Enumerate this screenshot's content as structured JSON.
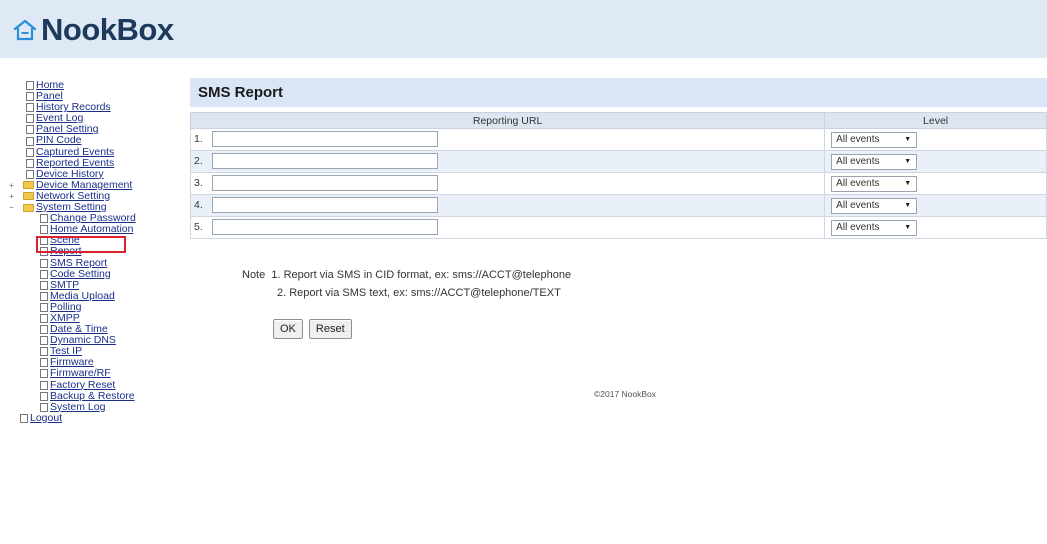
{
  "header": {
    "brand": "NookBox",
    "colors": {
      "header_bg": "#dfe9f5",
      "brand": "#1d3a5c"
    }
  },
  "sidebar": {
    "items": [
      {
        "label": "Home",
        "type": "doc",
        "level": 0
      },
      {
        "label": "Panel",
        "type": "doc",
        "level": 0
      },
      {
        "label": "History Records",
        "type": "doc",
        "level": 0
      },
      {
        "label": "Event Log",
        "type": "doc",
        "level": 0
      },
      {
        "label": "Panel Setting",
        "type": "doc",
        "level": 0
      },
      {
        "label": "PIN Code",
        "type": "doc",
        "level": 0
      },
      {
        "label": "Captured Events",
        "type": "doc",
        "level": 0
      },
      {
        "label": "Reported Events",
        "type": "doc",
        "level": 0
      },
      {
        "label": "Device History",
        "type": "doc",
        "level": 0
      },
      {
        "label": "Device Management",
        "type": "folder",
        "level": 0,
        "expander": "+"
      },
      {
        "label": "Network Setting",
        "type": "folder",
        "level": 0,
        "expander": "+"
      },
      {
        "label": "System Setting",
        "type": "folder",
        "level": 0,
        "expander": "−"
      },
      {
        "label": "Change Password",
        "type": "doc",
        "level": 1
      },
      {
        "label": "Home Automation",
        "type": "doc",
        "level": 1
      },
      {
        "label": "Scene",
        "type": "doc",
        "level": 1
      },
      {
        "label": "Report",
        "type": "doc",
        "level": 1
      },
      {
        "label": "SMS Report",
        "type": "doc",
        "level": 1,
        "selected": true
      },
      {
        "label": "Code Setting",
        "type": "doc",
        "level": 1
      },
      {
        "label": "SMTP",
        "type": "doc",
        "level": 1
      },
      {
        "label": "Media Upload",
        "type": "doc",
        "level": 1
      },
      {
        "label": "Polling",
        "type": "doc",
        "level": 1
      },
      {
        "label": "XMPP",
        "type": "doc",
        "level": 1
      },
      {
        "label": "Date & Time",
        "type": "doc",
        "level": 1
      },
      {
        "label": "Dynamic DNS",
        "type": "doc",
        "level": 1
      },
      {
        "label": "Test IP",
        "type": "doc",
        "level": 1
      },
      {
        "label": "Firmware",
        "type": "doc",
        "level": 1
      },
      {
        "label": "Firmware/RF",
        "type": "doc",
        "level": 1
      },
      {
        "label": "Factory Reset",
        "type": "doc",
        "level": 1
      },
      {
        "label": "Backup & Restore",
        "type": "doc",
        "level": 1
      },
      {
        "label": "System Log",
        "type": "doc",
        "level": 1
      },
      {
        "label": "Logout",
        "type": "doc",
        "level": -1
      }
    ],
    "highlight_color": "#d9232e"
  },
  "main": {
    "title": "SMS Report",
    "table": {
      "headers": [
        "Reporting URL",
        "Level"
      ],
      "rows": [
        {
          "num": "1.",
          "url": "",
          "level": "All events"
        },
        {
          "num": "2.",
          "url": "",
          "level": "All events"
        },
        {
          "num": "3.",
          "url": "",
          "level": "All events"
        },
        {
          "num": "4.",
          "url": "",
          "level": "All events"
        },
        {
          "num": "5.",
          "url": "",
          "level": "All events"
        }
      ]
    },
    "note": {
      "label": "Note",
      "line1": "1. Report via SMS in CID format, ex: sms://ACCT@telephone",
      "line2": "2. Report via SMS text, ex: sms://ACCT@telephone/TEXT"
    },
    "buttons": {
      "ok": "OK",
      "reset": "Reset"
    },
    "footer": "©2017 NookBox"
  }
}
